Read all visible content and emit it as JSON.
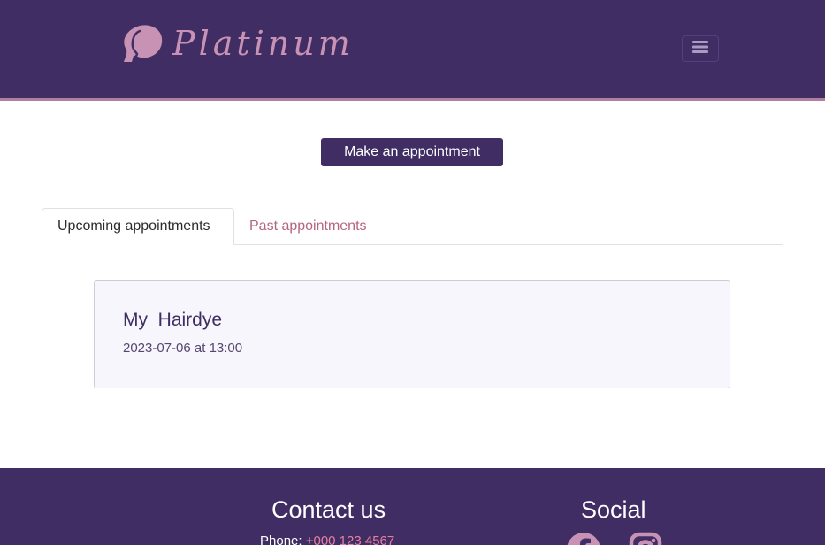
{
  "brand": {
    "name": "Platinum",
    "logo_icon": "woman-silhouette-icon",
    "color": "#c892b4"
  },
  "navbar": {
    "menu_icon": "hamburger-menu-icon",
    "background": "#3f2d63"
  },
  "actions": {
    "make_appointment": "Make an appointment"
  },
  "tabs": [
    {
      "label": "Upcoming appointments",
      "active": true
    },
    {
      "label": "Past appointments",
      "active": false
    }
  ],
  "appointments": [
    {
      "title": "My  Hairdye",
      "datetime": "2023-07-06 at 13:00"
    }
  ],
  "footer": {
    "contact_heading": "Contact us",
    "phone_label": "Phone:",
    "phone_number": "+000 123 4567",
    "social_heading": "Social",
    "social_icons": [
      "facebook-icon",
      "instagram-icon"
    ]
  },
  "colors": {
    "primary": "#3f2d63",
    "accent": "#b5657f",
    "link": "#e77ea0"
  }
}
